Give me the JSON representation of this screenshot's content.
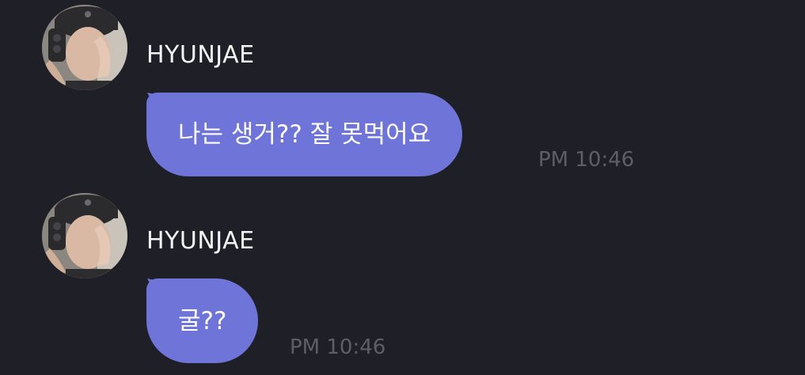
{
  "colors": {
    "background": "#1f1f27",
    "bubble": "#6e74d8",
    "bubble_text": "#ffffff",
    "sender_text": "#f4f4f4",
    "timestamp": "#5e5e66"
  },
  "messages": [
    {
      "sender": "HYUNJAE",
      "avatar_icon": "profile-photo",
      "text": "나는 생거?? 잘 못먹어요",
      "time": "PM 10:46"
    },
    {
      "sender": "HYUNJAE",
      "avatar_icon": "profile-photo",
      "text": "굴??",
      "time": "PM 10:46"
    }
  ]
}
